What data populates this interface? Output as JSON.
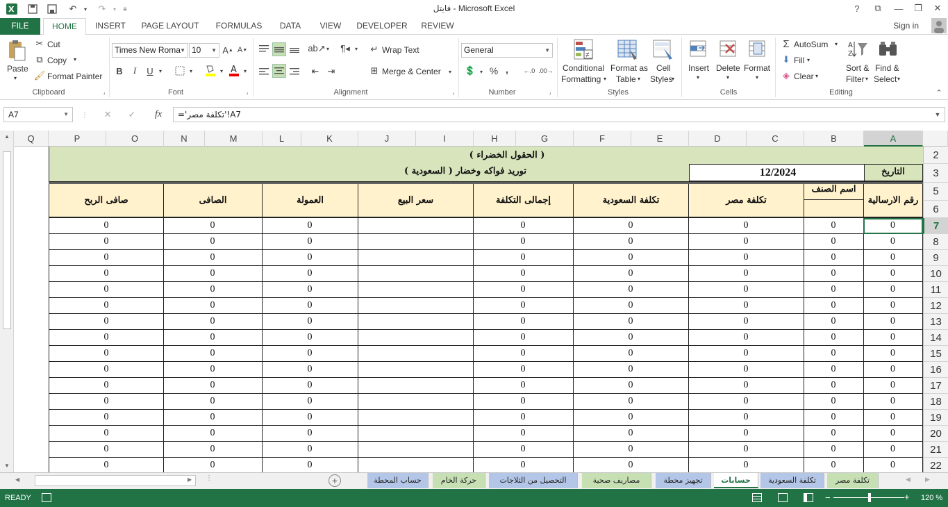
{
  "window": {
    "title": "فايتل - Microsoft Excel"
  },
  "icons": [
    "excel-icon",
    "save-icon",
    "undo-icon",
    "redo-icon",
    "help-icon",
    "restore-icon",
    "minimize-icon",
    "maximize-icon",
    "close-icon"
  ],
  "tabs": [
    {
      "label": "FILE"
    },
    {
      "label": "HOME"
    },
    {
      "label": "INSERT"
    },
    {
      "label": "PAGE LAYOUT"
    },
    {
      "label": "FORMULAS"
    },
    {
      "label": "DATA"
    },
    {
      "label": "VIEW"
    },
    {
      "label": "DEVELOPER"
    },
    {
      "label": "REVIEW"
    }
  ],
  "account": {
    "sign_in": "Sign in"
  },
  "ribbon": {
    "clipboard": {
      "paste": "Paste",
      "cut": "Cut",
      "copy": "Copy",
      "format_painter": "Format Painter",
      "label": "Clipboard"
    },
    "font": {
      "name": "Times New Roma",
      "size": "10",
      "bold": "B",
      "italic": "I",
      "underline": "U",
      "label": "Font"
    },
    "alignment": {
      "wrap_text": "Wrap Text",
      "merge_center": "Merge & Center",
      "label": "Alignment"
    },
    "number": {
      "format": "General",
      "percent": "%",
      "comma": ",",
      "label": "Number"
    },
    "styles": {
      "conditional_1": "Conditional",
      "conditional_2": "Formatting",
      "format_table_1": "Format as",
      "format_table_2": "Table",
      "cell_styles_1": "Cell",
      "cell_styles_2": "Styles",
      "label": "Styles"
    },
    "cells": {
      "insert": "Insert",
      "delete": "Delete",
      "format": "Format",
      "label": "Cells"
    },
    "editing": {
      "autosum": "AutoSum",
      "fill": "Fill",
      "clear": "Clear",
      "sort_1": "Sort &",
      "sort_2": "Filter",
      "find_1": "Find &",
      "find_2": "Select",
      "label": "Editing"
    }
  },
  "formula_bar": {
    "name_box": "A7",
    "fx": "fx",
    "formula": "='تكلفة مصر'!A7"
  },
  "columns": [
    "Q",
    "P",
    "O",
    "N",
    "M",
    "L",
    "K",
    "J",
    "I",
    "H",
    "G",
    "F",
    "E",
    "D",
    "C",
    "B",
    "A"
  ],
  "rows": [
    "2",
    "3",
    "5",
    "6",
    "7",
    "8",
    "9",
    "10",
    "11",
    "12",
    "13",
    "14",
    "15",
    "16",
    "17",
    "18",
    "19",
    "20",
    "21",
    "22"
  ],
  "sheet": {
    "title_1": "( الحقول الخضراء )",
    "title_2": "توريد فواكه وخضار   ( السعودية )",
    "date_label": "التاريخ",
    "date_value": "12/2024",
    "headers": {
      "shipment_no": "رقم الارسالية",
      "item_name": "اسم الصنف",
      "cost_egypt": "تكلفة  مصر",
      "cost_saudi": "تكلفة السعودية",
      "total_cost": "إجمالى التكلفة",
      "sale_price": "سعر البيع",
      "commission": "العمولة",
      "net": "الصافى",
      "net_profit": "صافى الربح"
    },
    "cell_value": "0"
  },
  "sheet_tabs": [
    {
      "label": "تكلفة مصر"
    },
    {
      "label": "تكلفة السعودية"
    },
    {
      "label": "حسابات"
    },
    {
      "label": "تجهيز محطة"
    },
    {
      "label": "مصاريف صحية"
    },
    {
      "label": "التحصيل من الثلاجات"
    },
    {
      "label": "حركة الخام"
    },
    {
      "label": "حساب المحطة"
    }
  ],
  "status": {
    "mode": "READY",
    "zoom": "120 %"
  },
  "colors": {
    "accent": "#217346",
    "green_fill": "#d8e4bc",
    "header_fill": "#fff2cc",
    "tab_blue": "#b4c6e7",
    "tab_green": "#c6e0b4"
  }
}
